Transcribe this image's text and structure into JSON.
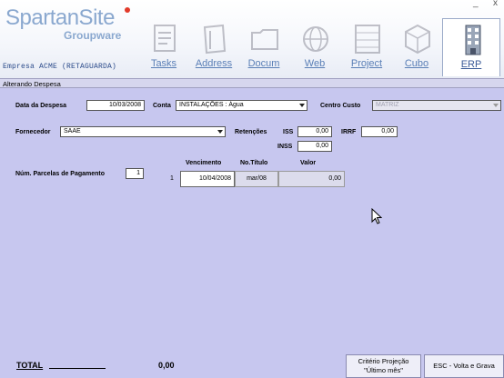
{
  "app": {
    "brand": "SpartanSite",
    "subtitle": "Groupware",
    "company": "Empresa ACME (RETAGUARDA)",
    "minimize": "_",
    "close": "x"
  },
  "nav": [
    {
      "label": "Tasks",
      "icon": "tasks-icon"
    },
    {
      "label": "Address",
      "icon": "address-book-icon"
    },
    {
      "label": "Docum",
      "icon": "folder-icon"
    },
    {
      "label": "Web",
      "icon": "globe-icon"
    },
    {
      "label": "Project",
      "icon": "project-icon"
    },
    {
      "label": "Cubo",
      "icon": "cube-icon"
    },
    {
      "label": "ERP",
      "icon": "building-icon",
      "active": true
    }
  ],
  "status": "Alterando Despesa",
  "form": {
    "data_label": "Data da Despesa",
    "data_value": "10/03/2008",
    "conta_label": "Conta",
    "conta_value": "INSTALAÇÕES : Água",
    "centro_label": "Centro Custo",
    "centro_value": "MATRIZ",
    "fornecedor_label": "Fornecedor",
    "fornecedor_value": "SAAE",
    "retencoes_label": "Retenções",
    "iss_label": "ISS",
    "iss_value": "0,00",
    "irrf_label": "IRRF",
    "irrf_value": "0,00",
    "inss_label": "INSS",
    "inss_value": "0,00",
    "parcelas_label": "Núm. Parcelas de Pagamento",
    "parcelas_value": "1"
  },
  "grid": {
    "headers": [
      "Vencimento",
      "No.Título",
      "Valor"
    ],
    "rows": [
      {
        "num": "1",
        "vencimento": "10/04/2008",
        "titulo": "mar/08",
        "valor": "0,00"
      }
    ]
  },
  "footer": {
    "total_label": "TOTAL",
    "total_value": "0,00",
    "criterio_line1": "Critério Projeção",
    "criterio_line2": "\"Último mês\"",
    "esc_label": "ESC - Volta e Grava"
  }
}
